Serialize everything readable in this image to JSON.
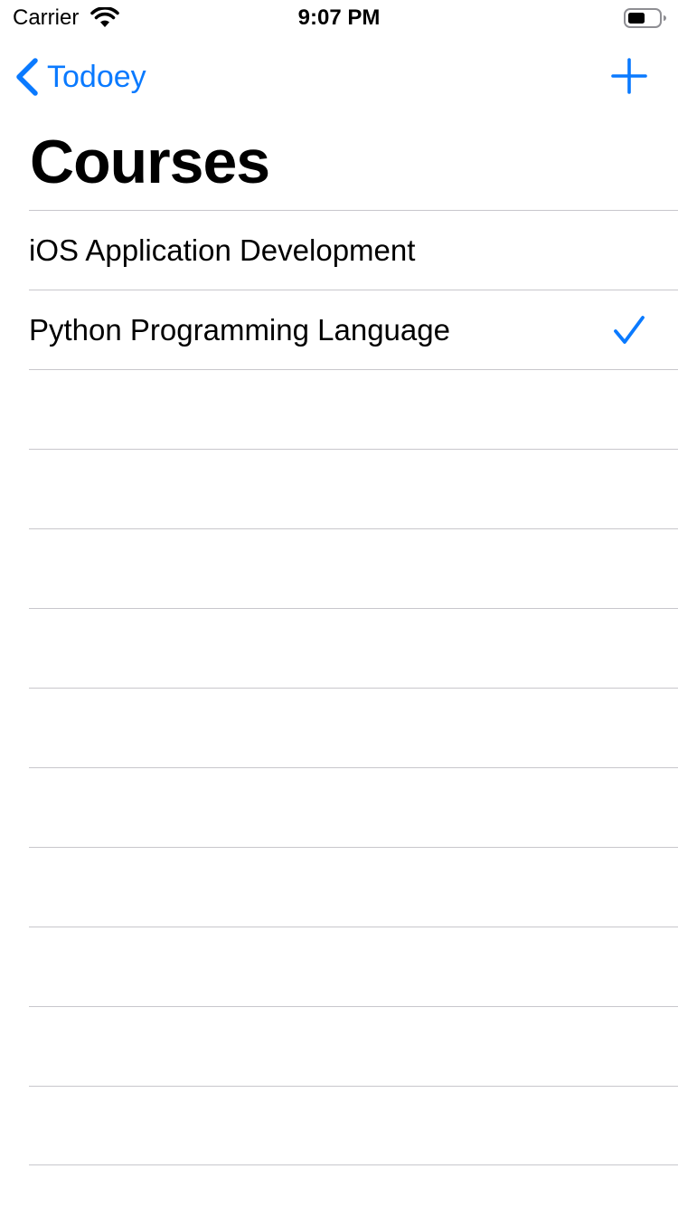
{
  "status_bar": {
    "carrier": "Carrier",
    "time": "9:07 PM"
  },
  "nav": {
    "back_label": "Todoey",
    "accent": "#0a7aff"
  },
  "title": "Courses",
  "items": [
    {
      "label": "iOS Application Development",
      "checked": false
    },
    {
      "label": "Python Programming Language",
      "checked": true
    }
  ],
  "empty_rows": 10
}
